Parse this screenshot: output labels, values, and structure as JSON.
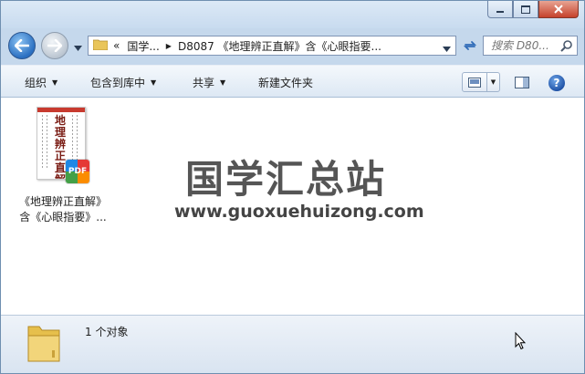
{
  "window": {
    "controls": {
      "minimize": "–",
      "maximize": "□",
      "close": "✕"
    }
  },
  "address": {
    "prefix": "«",
    "crumbs": [
      "国学...",
      "D8087 《地理辨正直解》含《心眼指要..."
    ],
    "search_placeholder": "搜索 D80..."
  },
  "toolbar": {
    "organize": "组织",
    "include_library": "包含到库中",
    "share": "共享",
    "new_folder": "新建文件夹",
    "help": "?"
  },
  "file": {
    "name_line1": "《地理辨正直解》",
    "name_line2": "含《心眼指要》...",
    "thumb_title": "地理辨正直解",
    "badge": "PDF"
  },
  "watermark": {
    "title": "国学汇总站",
    "url": "www.guoxuehuizong.com"
  },
  "details": {
    "count": "1 个对象"
  },
  "colors": {
    "frame": "#c5d8ec",
    "close": "#c5422b",
    "accent": "#2a6fc1"
  }
}
